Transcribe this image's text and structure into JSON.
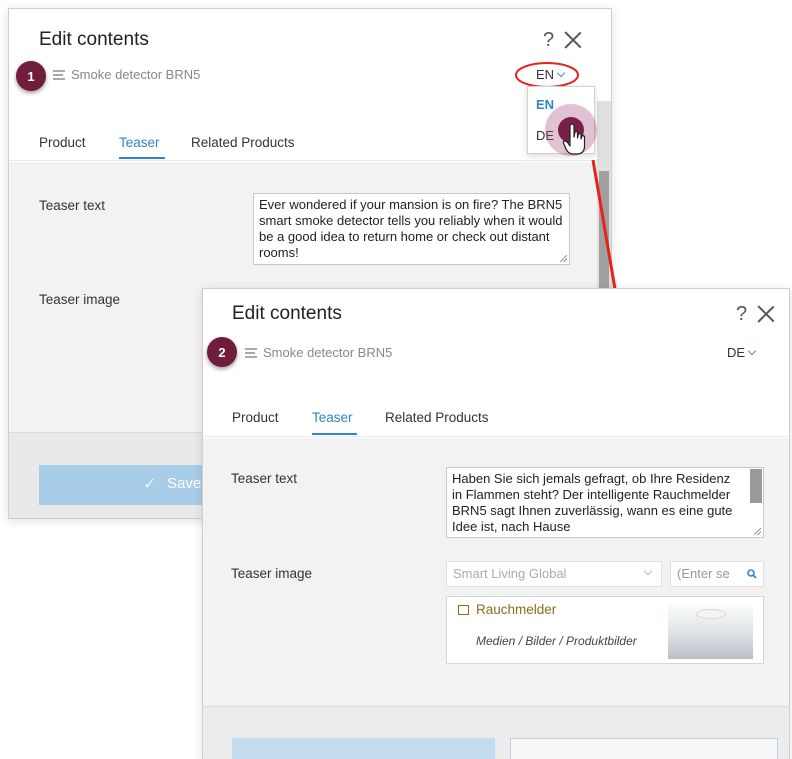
{
  "screen1": {
    "badge": "1",
    "title": "Edit contents",
    "help": "?",
    "subtitle": "Smoke detector BRN5",
    "language": "EN",
    "dropdown": {
      "options": [
        "EN",
        "DE"
      ]
    },
    "tabs": [
      {
        "label": "Product",
        "active": false
      },
      {
        "label": "Teaser",
        "active": true
      },
      {
        "label": "Related Products",
        "active": false
      }
    ],
    "teaser_text_label": "Teaser text",
    "teaser_text_value": "Ever wondered if your mansion is on fire? The BRN5 smart smoke detector tells you reliably when it would be a good idea to return home or check out distant rooms!",
    "teaser_image_label": "Teaser image",
    "save_label": "Save"
  },
  "screen2": {
    "badge": "2",
    "title": "Edit contents",
    "help": "?",
    "subtitle": "Smoke detector BRN5",
    "language": "DE",
    "tabs": [
      {
        "label": "Product",
        "active": false
      },
      {
        "label": "Teaser",
        "active": true
      },
      {
        "label": "Related Products",
        "active": false
      }
    ],
    "teaser_text_label": "Teaser text",
    "teaser_text_value": "Haben Sie sich jemals gefragt, ob Ihre Residenz in Flammen steht? Der intelligente Rauchmelder BRN5 sagt Ihnen zuverlässig, wann es eine gute Idee ist, nach Hause",
    "teaser_image_label": "Teaser image",
    "site_select_value": "Smart Living Global",
    "search_placeholder": "(Enter se",
    "picked_item": {
      "title": "Rauchmelder",
      "path": "Medien / Bilder / Produktbilder"
    }
  },
  "colors": {
    "accent": "#2f86c8",
    "badge": "#6f1d3a",
    "annotation_arrow": "#e8211a",
    "save_button": "#a8cde9",
    "item_title": "#8a6d1e"
  },
  "icons": [
    "menu-icon",
    "help-icon",
    "close-icon",
    "chevron-down-icon",
    "pointer-hand-icon",
    "document-icon",
    "search-icon",
    "check-icon",
    "arrow-annotation"
  ]
}
